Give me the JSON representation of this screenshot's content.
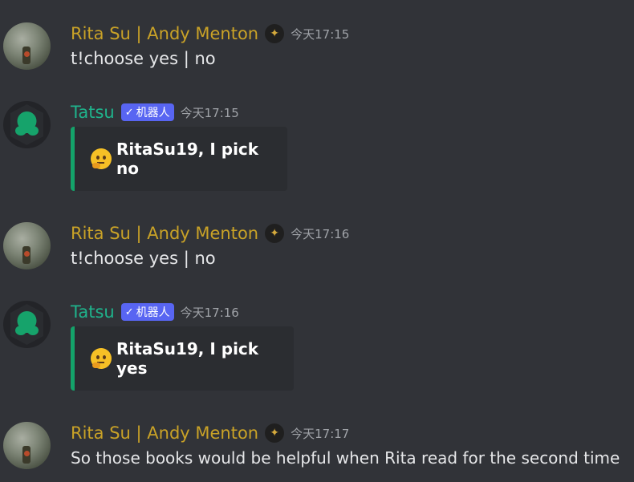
{
  "messages": [
    {
      "author": "Rita Su | Andy Menton",
      "time": "今天17:15",
      "content": "t!choose yes | no"
    },
    {
      "author": "Tatsu",
      "bot_tag": "机器人",
      "time": "今天17:15",
      "embed_text": "RitaSu19, I pick no",
      "embed_icon": "thinking-face-emoji"
    },
    {
      "author": "Rita Su | Andy Menton",
      "time": "今天17:16",
      "content": "t!choose yes | no"
    },
    {
      "author": "Tatsu",
      "bot_tag": "机器人",
      "time": "今天17:16",
      "embed_text": "RitaSu19, I pick yes",
      "embed_icon": "thinking-face-emoji"
    },
    {
      "author": "Rita Su | Andy Menton",
      "time": "今天17:17",
      "content": "So those books would be helpful when Rita read for the second time"
    }
  ],
  "colors": {
    "background": "#313338",
    "rita_name": "#c9a227",
    "tatsu_name": "#1fb38c",
    "bot_tag": "#5865f2",
    "embed_bg": "#2b2d31",
    "embed_border": "#14a36a"
  }
}
